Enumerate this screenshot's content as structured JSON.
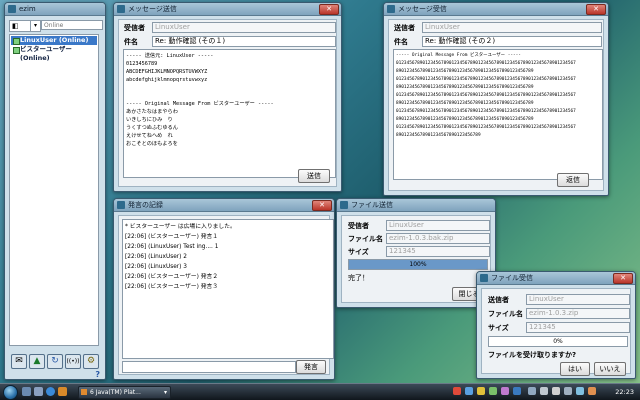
{
  "ezim": {
    "title": "ezim",
    "state_value": "",
    "state_placeholder": "Online",
    "users": [
      "LinuxUser (Online)",
      "ビスターユーザー (Online)"
    ],
    "tools": [
      "mail-icon",
      "up-arrow-icon",
      "refresh-icon",
      "broadcast-icon",
      "gear-icon"
    ],
    "help": "?"
  },
  "msg_compose": {
    "title": "メッセージ送信",
    "to_label": "受信者",
    "to_value": "LinuxUser",
    "subject_label": "件名",
    "subject_value": "Re: 動作確認 (その１)",
    "body": "----- 送信元: LinuxUser -----\n0123456789\nABCDEFGHIJKLMNOPQRSTUVWXYZ\nabcdefghijklmnopqrstuvwxyz\n\n\n----- Original Message From ビスターユーザー -----\nあかさたなはまやらわ\nいきしちにひみ　り\nうくすつぬふむゆるん\nえけせてねへめ　れ\nおこそとのほもよろを",
    "send": "送信"
  },
  "msg_receive": {
    "title": "メッセージ受信",
    "from_label": "送信者",
    "from_value": "LinuxUser",
    "subject_label": "件名",
    "subject_value": "Re: 動作確認 (その２)",
    "body": "----- Original Message From ビスターユーザー -----\n01234567890123456789012345678901234567890123456789012345678901234567\n8901234567890123456789012345678901234567890123456789\n01234567890123456789012345678901234567890123456789012345678901234567\n8901234567890123456789012345678901234567890123456789\n01234567890123456789012345678901234567890123456789012345678901234567\n8901234567890123456789012345678901234567890123456789\n01234567890123456789012345678901234567890123456789012345678901234567\n8901234567890123456789012345678901234567890123456789\n01234567890123456789012345678901234567890123456789012345678901234567\n89012345678901234567890123456789",
    "reply": "返信"
  },
  "log": {
    "title": "発言の記録",
    "lines": [
      "* ビスターユーザー は広場に入りました。",
      "[22:06] (ビスターユーザー) 発言１",
      "[22:06] (LinuxUser) Test ing.... 1",
      "[22:06] (LinuxUser) 2",
      "[22:06] (LinuxUser) 3",
      "[22:06] (ビスターユーザー) 発言２",
      "[22:06] (ビスターユーザー) 発言３"
    ],
    "input_value": "",
    "speak": "発言"
  },
  "ft_send": {
    "title": "ファイル送信",
    "to_label": "受信者",
    "to_value": "LinuxUser",
    "name_label": "ファイル名",
    "name_value": "ezim-1.0.3.bak.zip",
    "size_label": "サイズ",
    "size_value": "121345",
    "progress": 100,
    "progress_text": "100%",
    "status": "完了！",
    "close": "閉じる"
  },
  "ft_recv": {
    "title": "ファイル受信",
    "from_label": "送信者",
    "from_value": "LinuxUser",
    "name_label": "ファイル名",
    "name_value": "ezim-1.0.3.zip",
    "size_label": "サイズ",
    "size_value": "121345",
    "progress": 0,
    "progress_text": "0%",
    "question": "ファイルを受け取りますか?",
    "yes": "はい",
    "no": "いいえ"
  },
  "taskbar": {
    "task_label": "6 Java(TM) Plat...",
    "clock": "22:23"
  }
}
